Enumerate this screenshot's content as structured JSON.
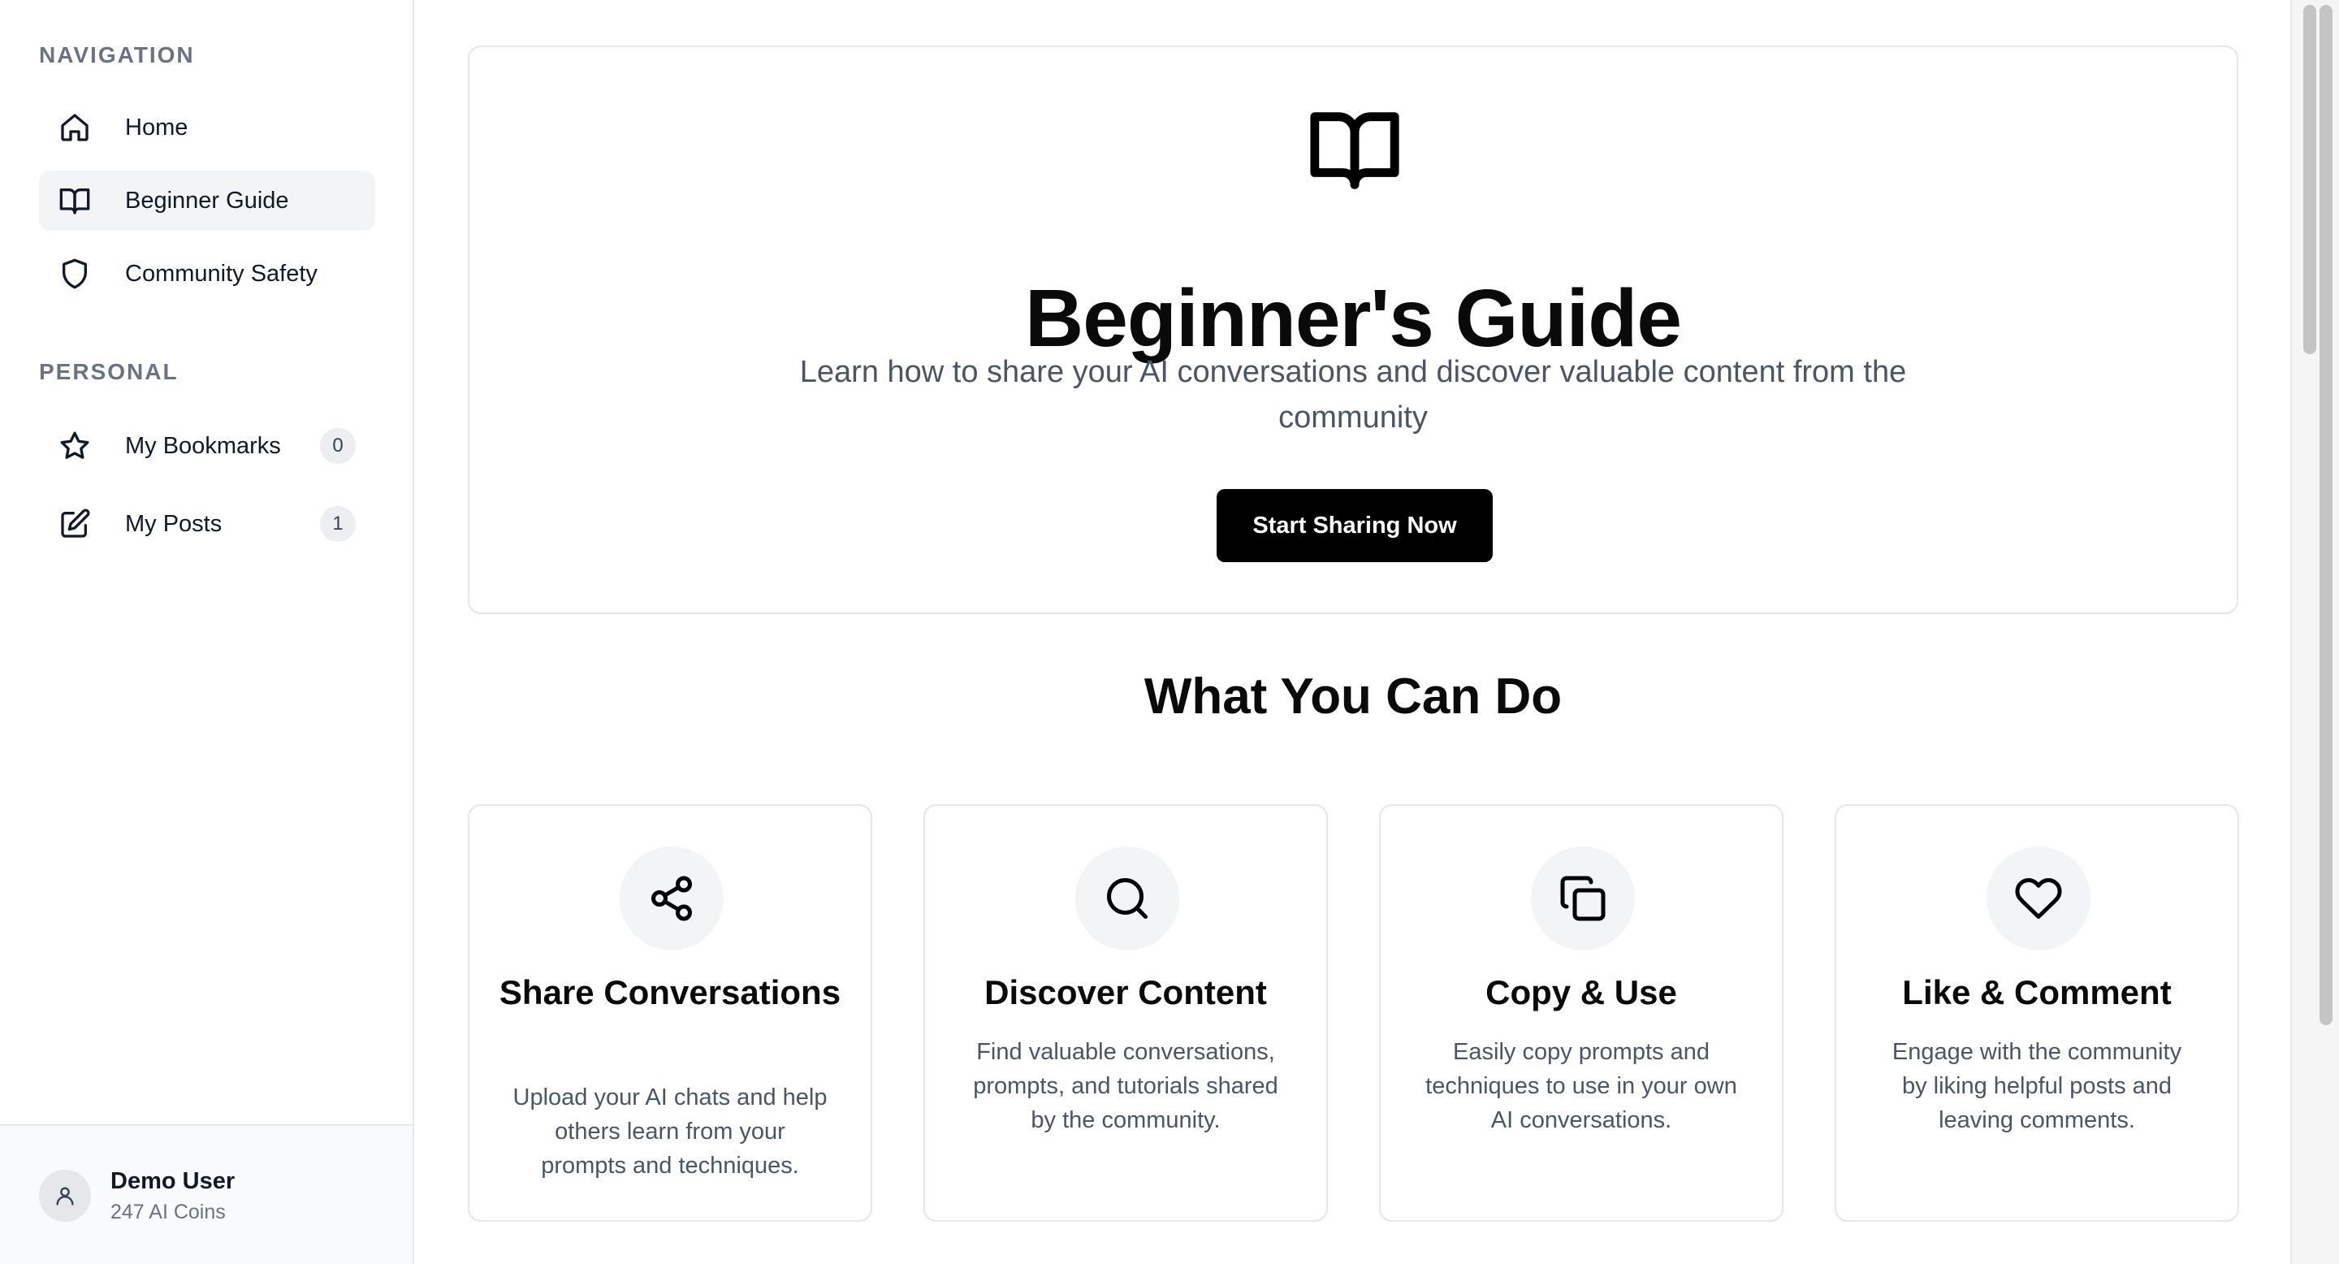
{
  "sidebar": {
    "navigation_heading": "NAVIGATION",
    "nav_items": [
      {
        "label": "Home",
        "icon": "home-icon"
      },
      {
        "label": "Beginner Guide",
        "icon": "book-open-icon",
        "active": true
      },
      {
        "label": "Community Safety",
        "icon": "shield-icon"
      }
    ],
    "personal_heading": "PERSONAL",
    "personal_items": [
      {
        "label": "My Bookmarks",
        "icon": "star-icon",
        "count": "0"
      },
      {
        "label": "My Posts",
        "icon": "edit-icon",
        "count": "1"
      }
    ],
    "user": {
      "name": "Demo User",
      "coins": "247 AI Coins",
      "icon": "user-icon"
    }
  },
  "hero": {
    "icon": "book-open-icon",
    "title": "Beginner's Guide",
    "subtitle": "Learn how to share your AI conversations and discover valuable content from the community",
    "cta_label": "Start Sharing Now"
  },
  "features": {
    "heading": "What You Can Do",
    "cards": [
      {
        "icon": "share-icon",
        "title": "Share Conversations",
        "description": "Upload your AI chats and help others learn from your prompts and techniques."
      },
      {
        "icon": "search-icon",
        "title": "Discover Content",
        "description": "Find valuable conversations, prompts, and tutorials shared by the community."
      },
      {
        "icon": "copy-icon",
        "title": "Copy & Use",
        "description": "Easily copy prompts and techniques to use in your own AI conversations."
      },
      {
        "icon": "heart-icon",
        "title": "Like & Comment",
        "description": "Engage with the community by liking helpful posts and leaving comments."
      }
    ]
  },
  "colors": {
    "accent": "#000000",
    "active_bg": "#f3f4f6",
    "border": "#e5e7eb",
    "muted_text": "#6b7280"
  }
}
